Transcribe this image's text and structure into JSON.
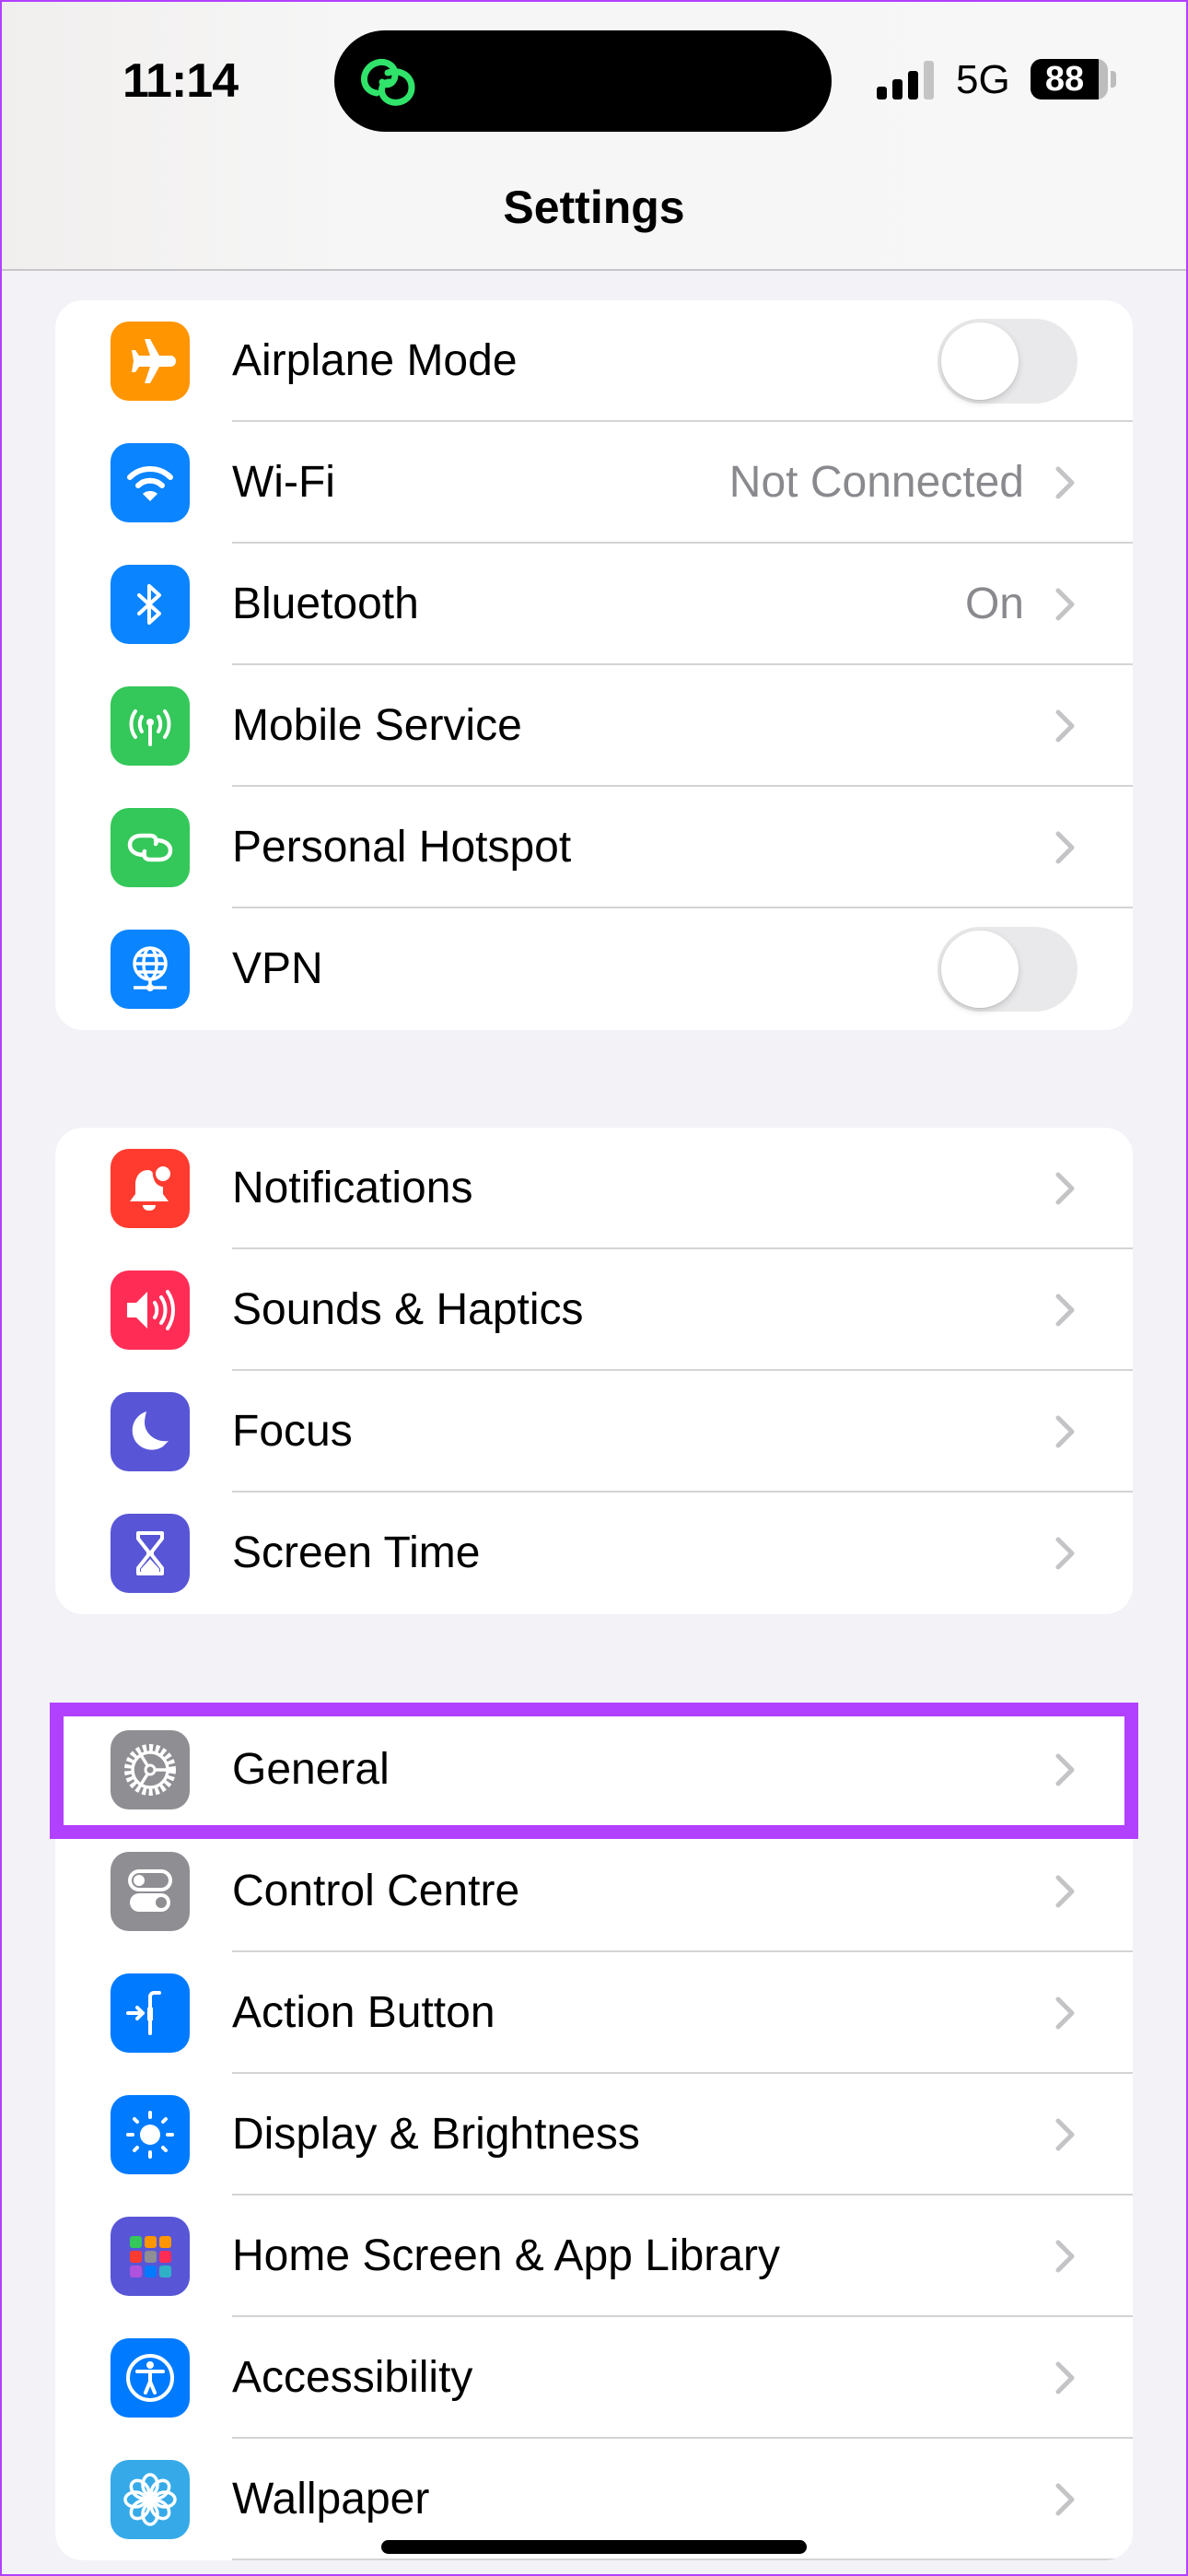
{
  "status_bar": {
    "time": "11:14",
    "network": "5G",
    "battery": "88",
    "battery_level": 0.88,
    "signal_bars_active": 3,
    "signal_bars_total": 4,
    "island_activity_icon": "personal-hotspot-link-icon"
  },
  "header": {
    "title": "Settings"
  },
  "colors": {
    "highlight": "#b240ff",
    "background": "#f2f2f7",
    "value_text": "#8a8a8e",
    "chevron": "#c4c4c7"
  },
  "groups": [
    {
      "items": [
        {
          "label": "Airplane Mode",
          "icon": "airplane-icon",
          "icon_color": "#ff9500",
          "accessory": "toggle",
          "toggle_on": false
        },
        {
          "label": "Wi-Fi",
          "icon": "wifi-icon",
          "icon_color": "#0a84ff",
          "value": "Not Connected",
          "accessory": "chevron"
        },
        {
          "label": "Bluetooth",
          "icon": "bluetooth-icon",
          "icon_color": "#0a84ff",
          "value": "On",
          "accessory": "chevron"
        },
        {
          "label": "Mobile Service",
          "icon": "antenna-icon",
          "icon_color": "#34c759",
          "accessory": "chevron"
        },
        {
          "label": "Personal Hotspot",
          "icon": "hotspot-link-icon",
          "icon_color": "#34c759",
          "accessory": "chevron"
        },
        {
          "label": "VPN",
          "icon": "vpn-globe-icon",
          "icon_color": "#0a84ff",
          "accessory": "toggle",
          "toggle_on": false
        }
      ]
    },
    {
      "items": [
        {
          "label": "Notifications",
          "icon": "bell-icon",
          "icon_color": "#ff3b30",
          "accessory": "chevron"
        },
        {
          "label": "Sounds & Haptics",
          "icon": "speaker-icon",
          "icon_color": "#ff2d55",
          "accessory": "chevron"
        },
        {
          "label": "Focus",
          "icon": "moon-icon",
          "icon_color": "#5856d6",
          "accessory": "chevron"
        },
        {
          "label": "Screen Time",
          "icon": "hourglass-icon",
          "icon_color": "#5856d6",
          "accessory": "chevron"
        }
      ]
    },
    {
      "items": [
        {
          "label": "General",
          "icon": "gear-icon",
          "icon_color": "#8e8e93",
          "accessory": "chevron",
          "highlighted": true
        },
        {
          "label": "Control Centre",
          "icon": "switches-icon",
          "icon_color": "#8e8e93",
          "accessory": "chevron"
        },
        {
          "label": "Action Button",
          "icon": "action-button-icon",
          "icon_color": "#007aff",
          "accessory": "chevron"
        },
        {
          "label": "Display & Brightness",
          "icon": "sun-icon",
          "icon_color": "#007aff",
          "accessory": "chevron"
        },
        {
          "label": "Home Screen & App Library",
          "icon": "app-grid-icon",
          "icon_color": "#5856d6",
          "accessory": "chevron"
        },
        {
          "label": "Accessibility",
          "icon": "accessibility-icon",
          "icon_color": "#007aff",
          "accessory": "chevron"
        },
        {
          "label": "Wallpaper",
          "icon": "flower-icon",
          "icon_color": "#36aae8",
          "accessory": "chevron"
        }
      ]
    }
  ]
}
